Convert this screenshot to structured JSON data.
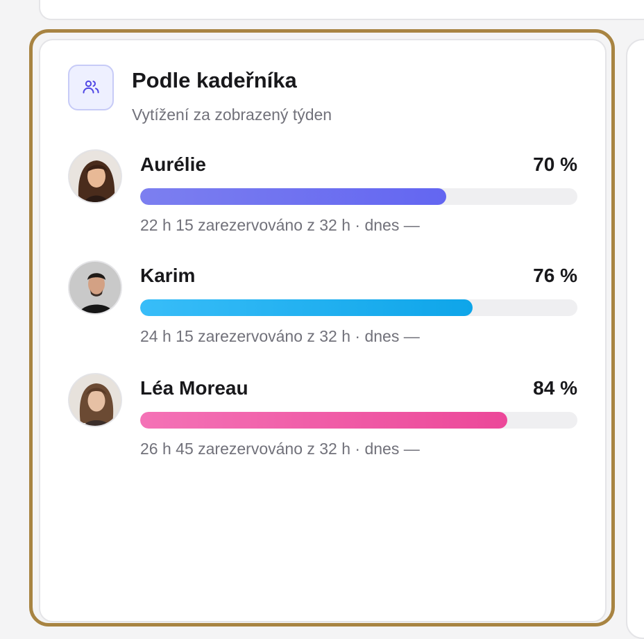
{
  "header": {
    "title": "Podle kadeřníka",
    "subtitle": "Vytížení za zobrazený týden",
    "icon": "users-icon"
  },
  "colors": {
    "frame": "#a88442",
    "icon_accent": "#4f46e5"
  },
  "stylists": [
    {
      "name": "Aurélie",
      "percent_label": "70 %",
      "utilization": 0.7,
      "meta": "22 h 15 zarezervováno z 32 h · dnes —",
      "bar_from": "#7c7ff0",
      "bar_to": "#6366f1",
      "avatar_icon": "woman-portrait-icon"
    },
    {
      "name": "Karim",
      "percent_label": "76 %",
      "utilization": 0.76,
      "meta": "24 h 15 zarezervováno z 32 h · dnes —",
      "bar_from": "#38bdf8",
      "bar_to": "#0ea5e9",
      "avatar_icon": "man-portrait-icon"
    },
    {
      "name": "Léa Moreau",
      "percent_label": "84 %",
      "utilization": 0.84,
      "meta": "26 h 45 zarezervováno z 32 h · dnes —",
      "bar_from": "#f472b6",
      "bar_to": "#ec4899",
      "avatar_icon": "woman-portrait-icon"
    }
  ]
}
